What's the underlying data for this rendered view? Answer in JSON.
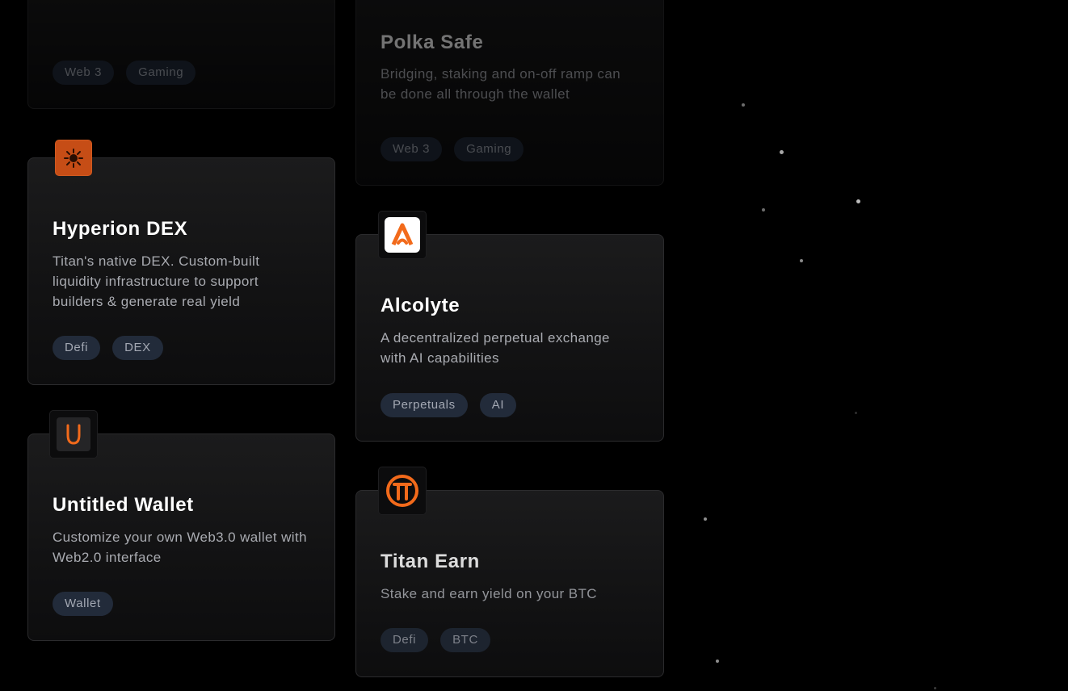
{
  "projects": [
    {
      "title": "",
      "description": "",
      "tags": [
        "Web 3",
        "Gaming"
      ]
    },
    {
      "title": "Polka Safe",
      "description": "Bridging, staking and on-off ramp can be done all through the wallet",
      "tags": [
        "Web 3",
        "Gaming"
      ]
    },
    {
      "title": "Hyperion DEX",
      "description": "Titan's native DEX. Custom-built liquidity infrastructure to support builders & generate real yield",
      "tags": [
        "Defi",
        "DEX"
      ],
      "icon": "hyperion-sun-icon"
    },
    {
      "title": "Alcolyte",
      "description": "A decentralized perpetual exchange with AI capabilities",
      "tags": [
        "Perpetuals",
        "AI"
      ],
      "icon": "alcolyte-a-icon"
    },
    {
      "title": "Untitled Wallet",
      "description": "Customize your own Web3.0 wallet with Web2.0 interface",
      "tags": [
        "Wallet"
      ],
      "icon": "untitled-u-icon"
    },
    {
      "title": "Titan Earn",
      "description": "Stake and earn yield on your BTC",
      "tags": [
        "Defi",
        "BTC"
      ],
      "icon": "titan-t-icon"
    }
  ],
  "colors": {
    "background": "#000000",
    "card": "#1b1b1c",
    "tag_background": "#222b3a",
    "accent_orange": "#f26a1b",
    "title_text": "#ffffff",
    "body_text": "#a9abb1"
  }
}
